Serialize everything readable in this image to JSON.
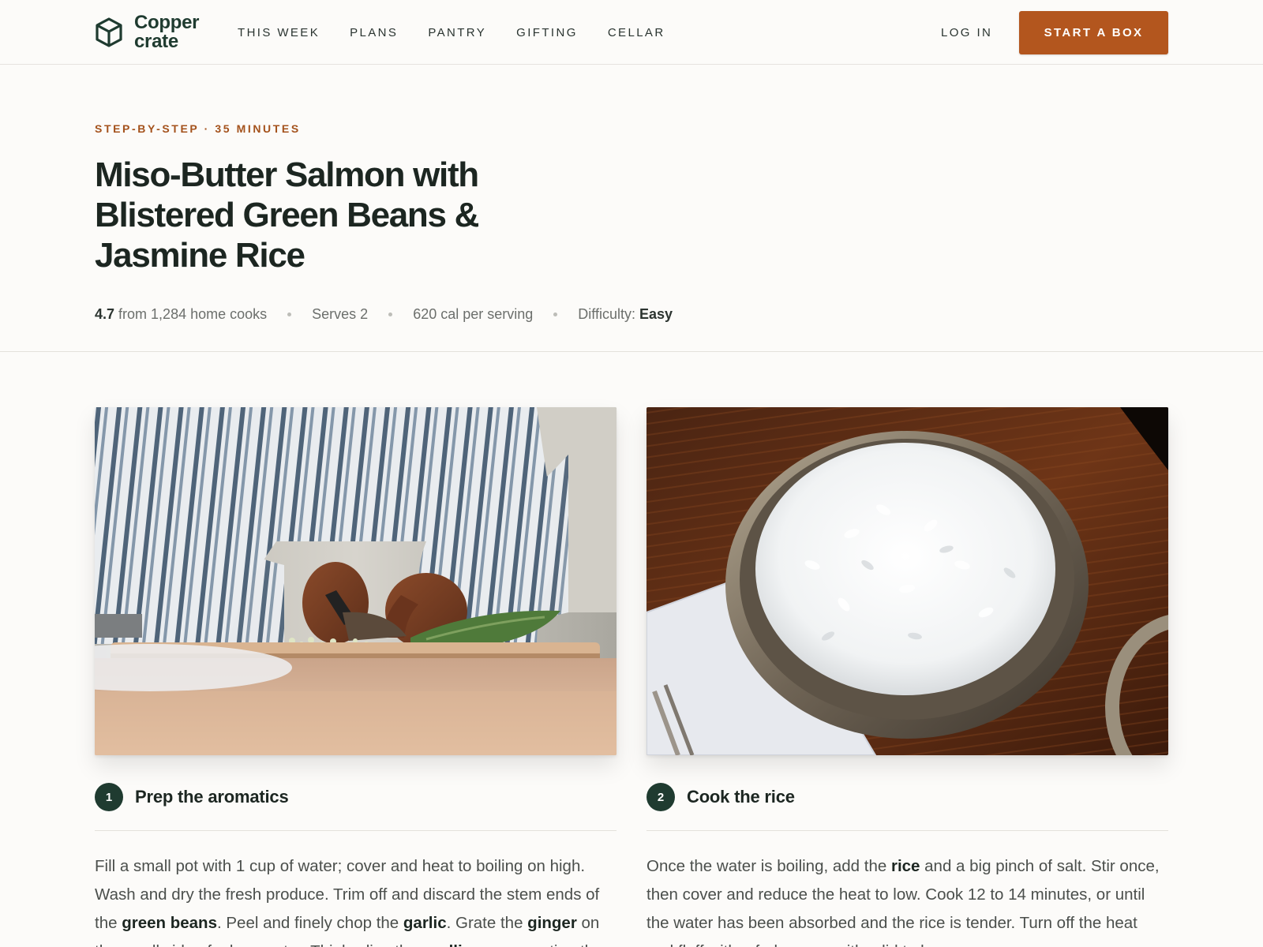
{
  "header": {
    "brand_line1": "Copper",
    "brand_line2": "crate",
    "nav": [
      "THIS WEEK",
      "PLANS",
      "PANTRY",
      "GIFTING",
      "CELLAR"
    ],
    "login_label": "LOG IN",
    "cta_label": "START A BOX"
  },
  "recipe": {
    "eyebrow": "STEP-BY-STEP · 35 MINUTES",
    "title": "Miso-Butter Salmon with Blistered Green Beans & Jasmine Rice",
    "rating_value": "4.7",
    "rating_text": "from 1,284 home cooks",
    "serves": "Serves 2",
    "calories": "620 cal per serving",
    "difficulty_label": "Difficulty:",
    "difficulty_value": "Easy"
  },
  "steps": [
    {
      "number": "1",
      "title": "Prep the aromatics",
      "photo": "chopping-greens-photo",
      "body": [
        {
          "t": "Fill a small pot with 1 cup of water; cover and heat to boiling on high. Wash and dry the fresh produce. Trim off and discard the stem ends of the ",
          "b": false
        },
        {
          "t": "green beans",
          "b": true
        },
        {
          "t": ". Peel and finely chop the ",
          "b": false
        },
        {
          "t": "garlic",
          "b": true
        },
        {
          "t": ". Grate the ",
          "b": false
        },
        {
          "t": "ginger",
          "b": true
        },
        {
          "t": " on the small side of a box grater. Thinly slice the ",
          "b": false
        },
        {
          "t": "scallions",
          "b": true
        },
        {
          "t": ", separating the whites and greens.",
          "b": false
        }
      ]
    },
    {
      "number": "2",
      "title": "Cook the rice",
      "photo": "rice-bowl-photo",
      "body": [
        {
          "t": "Once the water is boiling, add the ",
          "b": false
        },
        {
          "t": "rice",
          "b": true
        },
        {
          "t": " and a big pinch of salt. Stir once, then cover and reduce the heat to low. Cook 12 to 14 minutes, or until the water has been absorbed and the rice is tender. Turn off the heat and fluff with a fork; cover with a lid to keep warm.",
          "b": false
        }
      ]
    }
  ],
  "colors": {
    "accent": "#b3561e",
    "brand_green": "#1f3b30",
    "background": "#fcfbf9"
  }
}
